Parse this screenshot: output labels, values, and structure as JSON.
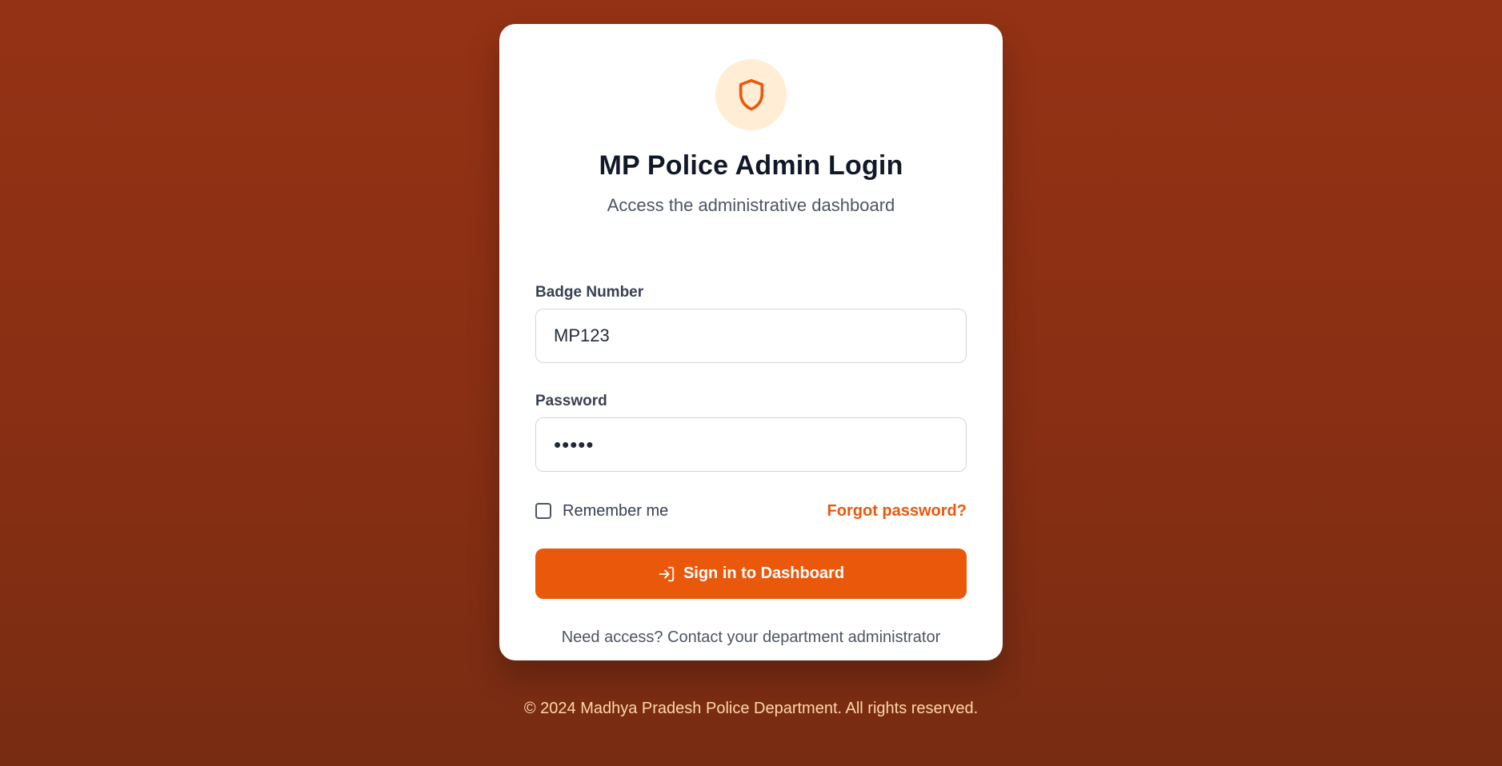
{
  "colors": {
    "background_top": "#943215",
    "background_bottom": "#782c12",
    "accent": "#ea580c",
    "logo_circle": "#ffedd5",
    "footer_text": "#fed7aa"
  },
  "login": {
    "logo_icon": "shield-icon",
    "title": "MP Police Admin Login",
    "subtitle": "Access the administrative dashboard",
    "badge": {
      "label": "Badge Number",
      "value": "MP123"
    },
    "password": {
      "label": "Password",
      "value": "•••••"
    },
    "remember": {
      "label": "Remember me",
      "checked": false
    },
    "forgot_label": "Forgot password?",
    "signin_icon": "login-arrow-icon",
    "signin_label": "Sign in to Dashboard",
    "help_text": "Need access? Contact your department administrator"
  },
  "footer": {
    "text": "© 2024 Madhya Pradesh Police Department. All rights reserved."
  }
}
